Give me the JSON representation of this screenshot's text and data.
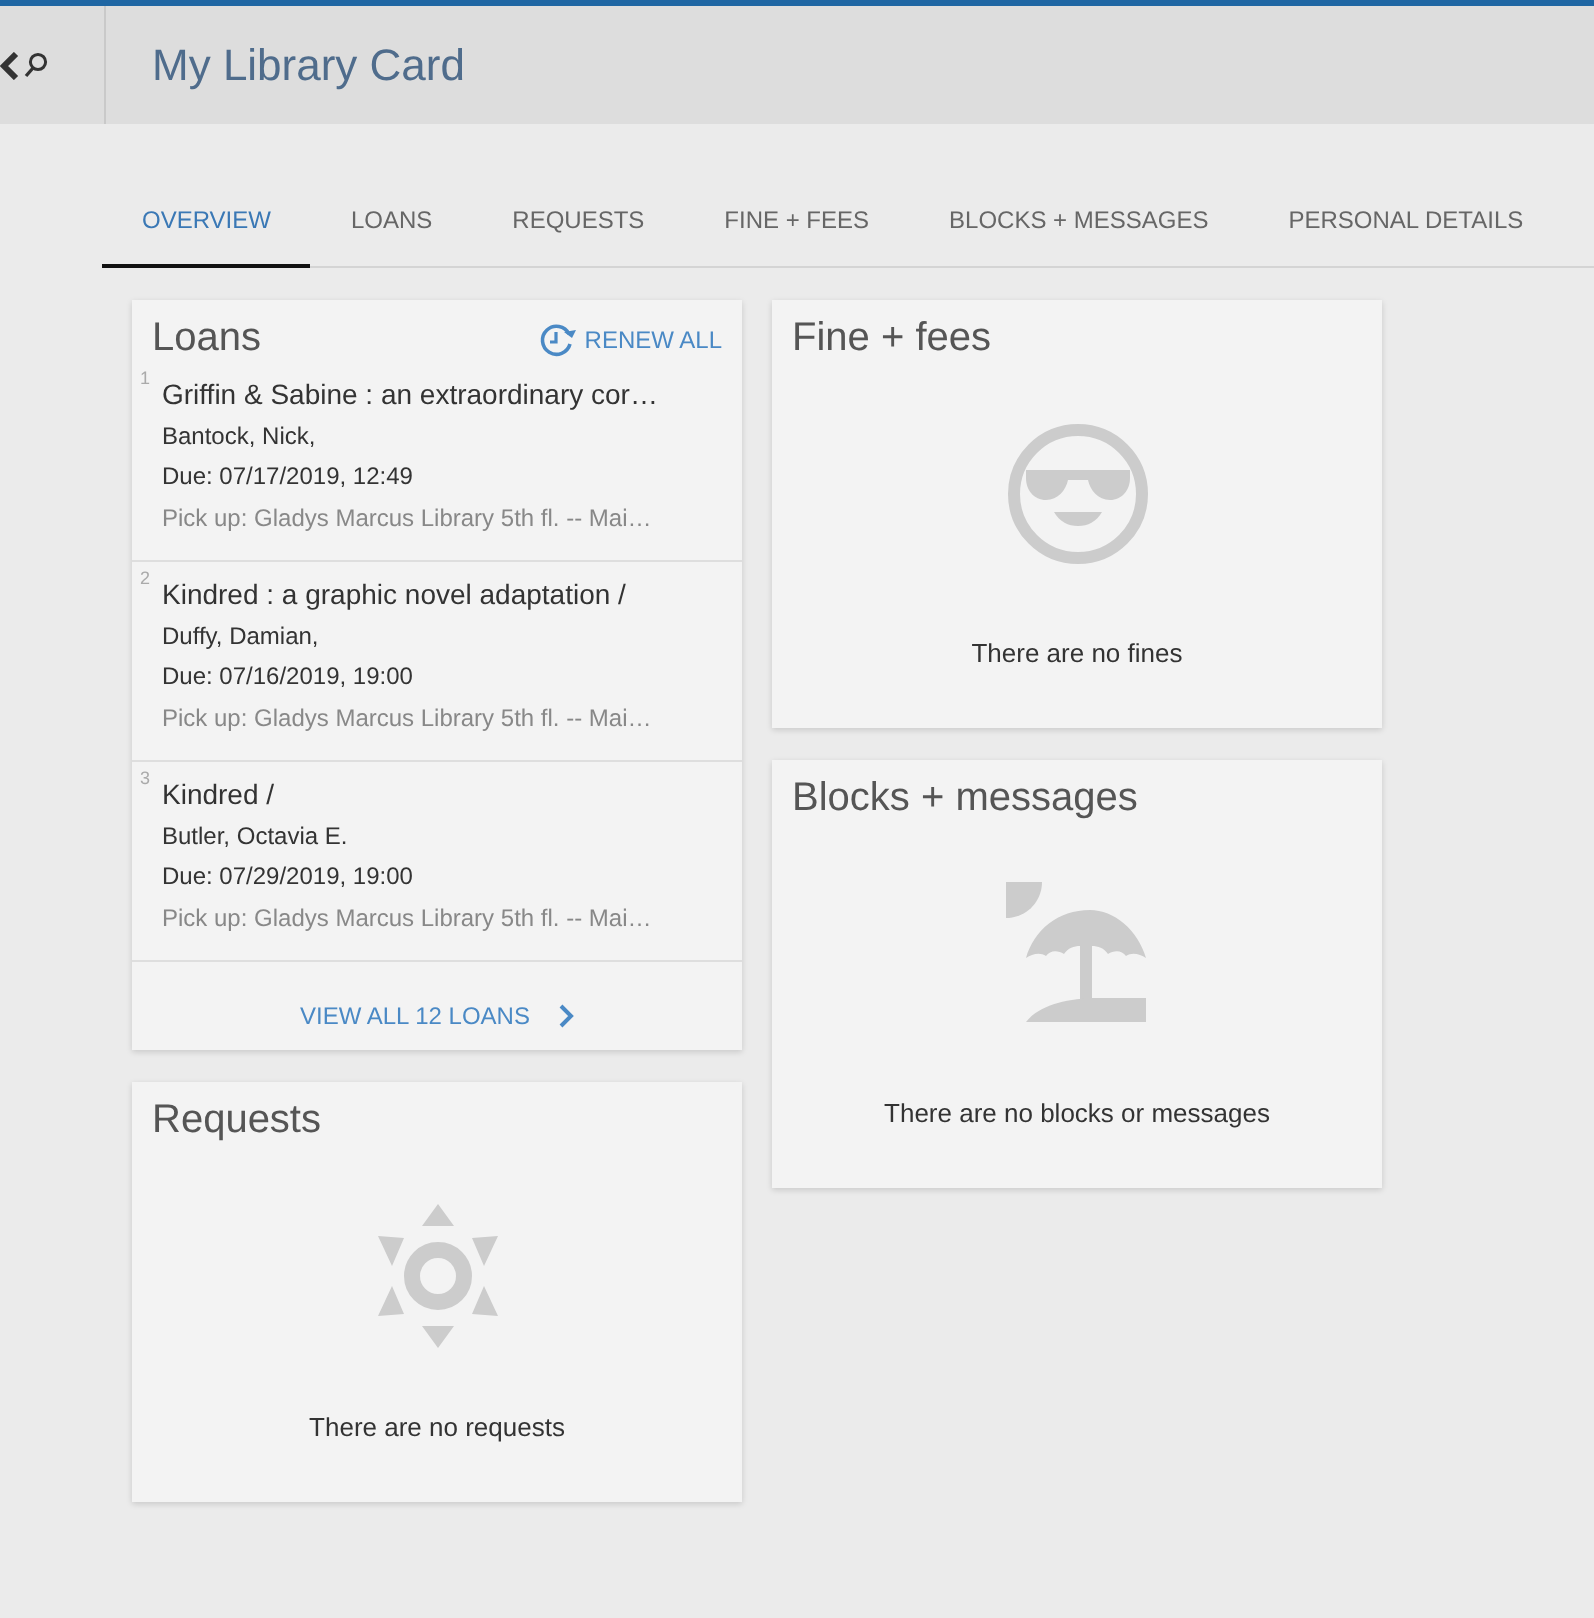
{
  "header": {
    "title": "My Library Card"
  },
  "tabs": [
    {
      "label": "OVERVIEW",
      "selected": true
    },
    {
      "label": "LOANS",
      "selected": false
    },
    {
      "label": "REQUESTS",
      "selected": false
    },
    {
      "label": "FINE + FEES",
      "selected": false
    },
    {
      "label": "BLOCKS + MESSAGES",
      "selected": false
    },
    {
      "label": "PERSONAL DETAILS",
      "selected": false
    }
  ],
  "columns": [
    [
      {
        "kind": "loans",
        "title": "Loans",
        "action": "RENEW ALL",
        "items": [
          {
            "number": "1",
            "title": "Griffin & Sabine : an extraordinary cor…",
            "author": "Bantock, Nick,",
            "due": "Due: 07/17/2019, 12:49",
            "pickup": "Pick up: Gladys Marcus Library 5th fl. -- Mai…"
          },
          {
            "number": "2",
            "title": "Kindred : a graphic novel adaptation /",
            "author": "Duffy, Damian,",
            "due": "Due: 07/16/2019, 19:00",
            "pickup": "Pick up: Gladys Marcus Library 5th fl. -- Mai…"
          },
          {
            "number": "3",
            "title": "Kindred /",
            "author": "Butler, Octavia E.",
            "due": "Due: 07/29/2019, 19:00",
            "pickup": "Pick up: Gladys Marcus Library 5th fl. -- Mai…"
          }
        ],
        "footer_link": "VIEW ALL 12 LOANS"
      },
      {
        "kind": "requests",
        "title": "Requests",
        "message": "There are no requests"
      }
    ],
    [
      {
        "kind": "fines",
        "title": "Fine + fees",
        "message": "There are no fines"
      },
      {
        "kind": "blocks",
        "title": "Blocks + messages",
        "message": "There are no blocks or messages"
      }
    ]
  ]
}
